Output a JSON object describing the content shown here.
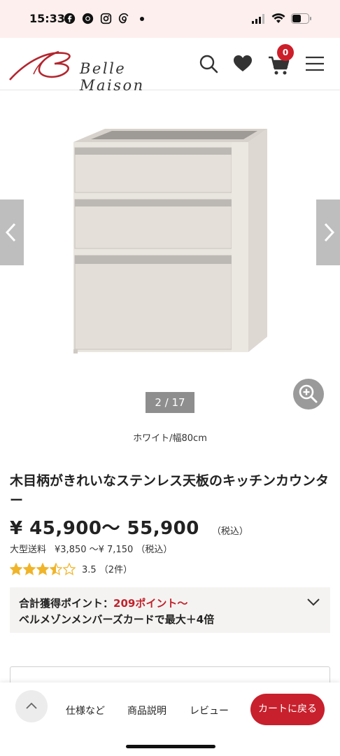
{
  "status_bar": {
    "time": "15:33",
    "left_icons": [
      "facebook-icon",
      "chrome-icon",
      "instagram-icon",
      "threads-icon"
    ],
    "right_icons": [
      "signal-icon",
      "wifi-icon",
      "battery-icon"
    ]
  },
  "header": {
    "logo_text": "Belle Maison",
    "cart_count": "0",
    "icons": [
      "search-icon",
      "heart-icon",
      "cart-icon",
      "menu-icon"
    ]
  },
  "gallery": {
    "counter": "2 / 17",
    "variant_caption": "ホワイト/幅80cm"
  },
  "product": {
    "title": "木目柄がきれいなステンレス天板のキッチンカウンター",
    "price": "¥ 45,900〜 55,900",
    "tax_label": "（税込）",
    "shipping_label": "大型送料",
    "shipping_values": "¥3,850 〜¥ 7,150 （税込）",
    "rating": 3.5,
    "rating_text": "3.5 （2件）"
  },
  "points": {
    "label": "合計獲得ポイント：",
    "value": "209ポイント〜",
    "line2": "ベルメゾンメンバーズカードで最大＋4倍"
  },
  "bottom_bar": {
    "nav": [
      "仕様など",
      "商品説明",
      "レビュー"
    ],
    "back_to_cart": "カートに戻る"
  },
  "colors": {
    "accent_red": "#c8202c",
    "status_bg": "#fcefed",
    "star": "#f0b429"
  }
}
